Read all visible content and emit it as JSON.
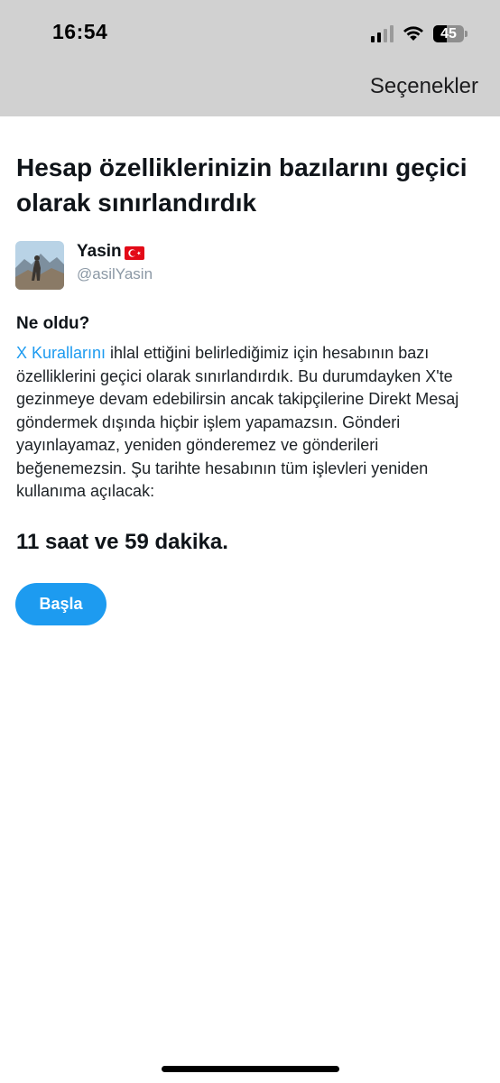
{
  "status_bar": {
    "time": "16:54",
    "battery": "45",
    "battery_level": 0.45
  },
  "header": {
    "options_label": "Seçenekler"
  },
  "title": "Hesap özelliklerinizin bazılarını geçici olarak sınırlandırdık",
  "user": {
    "name": "Yasin",
    "handle": "@asilYasin"
  },
  "section": {
    "heading": "Ne oldu?",
    "link_text": "X Kurallarını",
    "body": " ihlal ettiğini belirlediğimiz için hesabının bazı özelliklerini geçici olarak sınırlandırdık. Bu durumdayken X'te gezinmeye devam edebilirsin ancak takipçilerine Direkt Mesaj göndermek dışında hiçbir işlem yapamazsın. Gönderi yayınlayamaz, yeniden gönderemez ve gönderileri beğenemezsin. Şu tarihte hesabının tüm işlevleri yeniden kullanıma açılacak:"
  },
  "countdown": "11 saat ve 59 dakika.",
  "start_button_label": "Başla",
  "colors": {
    "accent": "#1d9bf0",
    "header_bg": "#d1d1d1",
    "flag_red": "#e30a17"
  }
}
